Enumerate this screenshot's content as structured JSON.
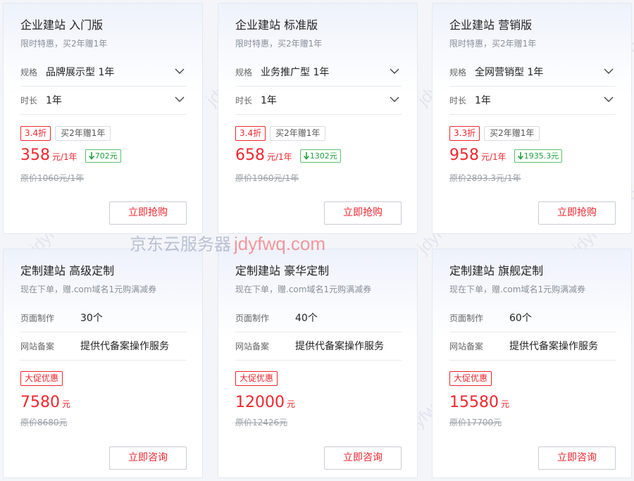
{
  "top_cards": [
    {
      "title": "企业建站 入门版",
      "subtitle": "限时特惠，买2年赠1年",
      "spec_label": "规格",
      "spec_value": "品牌展示型 1年",
      "duration_label": "时长",
      "duration_value": "1年",
      "discount": "3.4折",
      "promo": "买2年赠1年",
      "price": "358",
      "price_unit": "元/1年",
      "saving": "702元",
      "original": "原价1060元/1年",
      "button": "立即抢购"
    },
    {
      "title": "企业建站 标准版",
      "subtitle": "限时特惠，买2年赠1年",
      "spec_label": "规格",
      "spec_value": "业务推广型 1年",
      "duration_label": "时长",
      "duration_value": "1年",
      "discount": "3.4折",
      "promo": "买2年赠1年",
      "price": "658",
      "price_unit": "元/1年",
      "saving": "1302元",
      "original": "原价1960元/1年",
      "button": "立即抢购"
    },
    {
      "title": "企业建站 营销版",
      "subtitle": "限时特惠，买2年赠1年",
      "spec_label": "规格",
      "spec_value": "全网营销型 1年",
      "duration_label": "时长",
      "duration_value": "1年",
      "discount": "3.3折",
      "promo": "买2年赠1年",
      "price": "958",
      "price_unit": "元/1年",
      "saving": "1935.3元",
      "original": "原价2893.3元/1年",
      "button": "立即抢购"
    }
  ],
  "bottom_cards": [
    {
      "title": "定制建站 高级定制",
      "subtitle": "现在下单，赠.com域名1元购满减券",
      "pages_label": "页面制作",
      "pages_value": "30个",
      "icp_label": "网站备案",
      "icp_value": "提供代备案操作服务",
      "badge": "大促优惠",
      "price": "7580",
      "price_unit": "元",
      "original": "原价8680元",
      "button": "立即咨询"
    },
    {
      "title": "定制建站 豪华定制",
      "subtitle": "现在下单，赠.com域名1元购满减券",
      "pages_label": "页面制作",
      "pages_value": "40个",
      "icp_label": "网站备案",
      "icp_value": "提供代备案操作服务",
      "badge": "大促优惠",
      "price": "12000",
      "price_unit": "元",
      "original": "原价12426元",
      "button": "立即咨询"
    },
    {
      "title": "定制建站 旗舰定制",
      "subtitle": "现在下单，赠.com域名1元购满减券",
      "pages_label": "页面制作",
      "pages_value": "60个",
      "icp_label": "网站备案",
      "icp_value": "提供代备案操作服务",
      "badge": "大促优惠",
      "price": "15580",
      "price_unit": "元",
      "original": "原价17700元",
      "button": "立即咨询"
    }
  ],
  "watermark": {
    "cn": "京东云服务器",
    "en": "jdyfwq.com",
    "tile": "jdyfwq.com"
  },
  "icons": {
    "select": "chevron-down-icon",
    "saving": "arrow-down-icon"
  },
  "colors": {
    "accent_red": "#f0262d",
    "saving_green": "#1fa03a"
  }
}
